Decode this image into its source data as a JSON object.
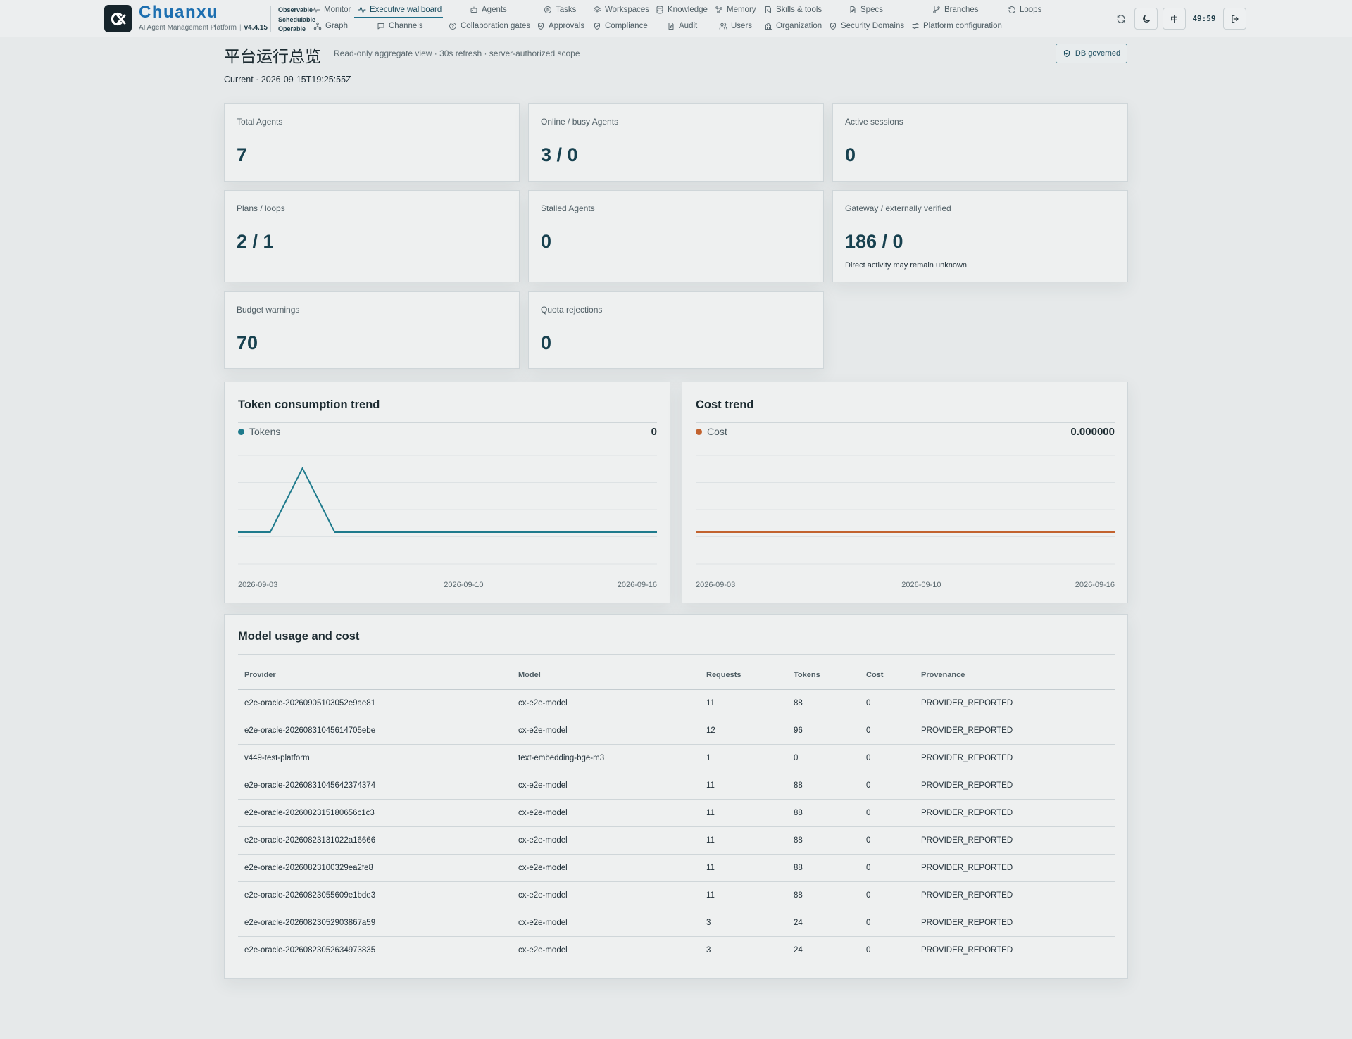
{
  "brand": {
    "name": "Chuanxu",
    "subtitle": "AI Agent Management Platform",
    "version": "v4.4.15",
    "badges": [
      "Observable",
      "Schedulable",
      "Operable"
    ]
  },
  "nav": {
    "row1": [
      {
        "label": "Monitor",
        "icon": "pulse-icon"
      },
      {
        "label": "Executive wallboard",
        "icon": "activity-icon",
        "active": true
      },
      {
        "label": "Agents",
        "icon": "robot-icon"
      },
      {
        "label": "Tasks",
        "icon": "play-circle-icon"
      },
      {
        "label": "Workspaces",
        "icon": "layers-icon"
      },
      {
        "label": "Knowledge",
        "icon": "database-icon"
      },
      {
        "label": "Memory",
        "icon": "nodes-icon"
      },
      {
        "label": "Skills & tools",
        "icon": "tool-icon"
      },
      {
        "label": "Specs",
        "icon": "doc-edit-icon"
      },
      {
        "label": "Branches",
        "icon": "branch-icon"
      },
      {
        "label": "Loops",
        "icon": "refresh-icon"
      }
    ],
    "row2": [
      {
        "label": "Graph",
        "icon": "graph-icon"
      },
      {
        "label": "Channels",
        "icon": "chat-icon"
      },
      {
        "label": "Collaboration gates",
        "icon": "help-circle-icon"
      },
      {
        "label": "Approvals",
        "icon": "shield-check-icon"
      },
      {
        "label": "Compliance",
        "icon": "shield-check-icon"
      },
      {
        "label": "Audit",
        "icon": "doc-edit-icon"
      },
      {
        "label": "Users",
        "icon": "users-icon"
      },
      {
        "label": "Organization",
        "icon": "building-icon"
      },
      {
        "label": "Security Domains",
        "icon": "shield-check-icon"
      },
      {
        "label": "Platform configuration",
        "icon": "sliders-icon"
      }
    ]
  },
  "toolbar": {
    "language_label": "中",
    "session_timer": "49:59"
  },
  "header": {
    "title": "平台运行总览",
    "subtitle": "Read-only aggregate view · 30s refresh · server-authorized scope",
    "db_badge": "DB governed",
    "current": "Current · 2026-09-15T19:25:55Z"
  },
  "stats": [
    {
      "label": "Total Agents",
      "value": "7"
    },
    {
      "label": "Online / busy Agents",
      "value": "3 / 0"
    },
    {
      "label": "Active sessions",
      "value": "0"
    },
    {
      "label": "Plans / loops",
      "value": "2 / 1"
    },
    {
      "label": "Stalled Agents",
      "value": "0"
    },
    {
      "label": "Gateway / externally verified",
      "value": "186 / 0",
      "note": "Direct activity may remain unknown"
    },
    {
      "label": "Budget warnings",
      "value": "70"
    },
    {
      "label": "Quota rejections",
      "value": "0"
    }
  ],
  "charts": {
    "tokens": {
      "title": "Token consumption trend",
      "series_label": "Tokens",
      "latest": "0",
      "color": "#1e7a8c"
    },
    "cost": {
      "title": "Cost trend",
      "series_label": "Cost",
      "latest": "0.000000",
      "color": "#c2622e"
    }
  },
  "chart_data": [
    {
      "type": "line",
      "title": "Token consumption trend",
      "x": [
        "2026-09-03",
        "2026-09-04",
        "2026-09-05",
        "2026-09-06",
        "2026-09-07",
        "2026-09-08",
        "2026-09-09",
        "2026-09-10",
        "2026-09-11",
        "2026-09-12",
        "2026-09-13",
        "2026-09-14",
        "2026-09-15",
        "2026-09-16"
      ],
      "series": [
        {
          "name": "Tokens",
          "values": [
            0,
            0,
            100,
            0,
            0,
            0,
            0,
            0,
            0,
            0,
            0,
            0,
            0,
            0
          ]
        }
      ],
      "x_tick_labels": [
        "2026-09-03",
        "2026-09-10",
        "2026-09-16"
      ],
      "grid": true,
      "legend": "top-left"
    },
    {
      "type": "line",
      "title": "Cost trend",
      "x": [
        "2026-09-03",
        "2026-09-04",
        "2026-09-05",
        "2026-09-06",
        "2026-09-07",
        "2026-09-08",
        "2026-09-09",
        "2026-09-10",
        "2026-09-11",
        "2026-09-12",
        "2026-09-13",
        "2026-09-14",
        "2026-09-15",
        "2026-09-16"
      ],
      "series": [
        {
          "name": "Cost",
          "values": [
            0,
            0,
            0,
            0,
            0,
            0,
            0,
            0,
            0,
            0,
            0,
            0,
            0,
            0
          ]
        }
      ],
      "x_tick_labels": [
        "2026-09-03",
        "2026-09-10",
        "2026-09-16"
      ],
      "grid": true,
      "legend": "top-left"
    }
  ],
  "model_table": {
    "title": "Model usage and cost",
    "columns": [
      "Provider",
      "Model",
      "Requests",
      "Tokens",
      "Cost",
      "Provenance"
    ],
    "rows": [
      [
        "e2e-oracle-20260905103052e9ae81",
        "cx-e2e-model",
        "11",
        "88",
        "0",
        "PROVIDER_REPORTED"
      ],
      [
        "e2e-oracle-20260831045614705ebe",
        "cx-e2e-model",
        "12",
        "96",
        "0",
        "PROVIDER_REPORTED"
      ],
      [
        "v449-test-platform",
        "text-embedding-bge-m3",
        "1",
        "0",
        "0",
        "PROVIDER_REPORTED"
      ],
      [
        "e2e-oracle-20260831045642374374",
        "cx-e2e-model",
        "11",
        "88",
        "0",
        "PROVIDER_REPORTED"
      ],
      [
        "e2e-oracle-202608231518065 6c1c3",
        "cx-e2e-model",
        "11",
        "88",
        "0",
        "PROVIDER_REPORTED"
      ],
      [
        "e2e-oracle-20260823131022a16666",
        "cx-e2e-model",
        "11",
        "88",
        "0",
        "PROVIDER_REPORTED"
      ],
      [
        "e2e-oracle-20260823100329ea2fe8",
        "cx-e2e-model",
        "11",
        "88",
        "0",
        "PROVIDER_REPORTED"
      ],
      [
        "e2e-oracle-20260823055609e1bde3",
        "cx-e2e-model",
        "11",
        "88",
        "0",
        "PROVIDER_REPORTED"
      ],
      [
        "e2e-oracle-20260823052903867a59",
        "cx-e2e-model",
        "3",
        "24",
        "0",
        "PROVIDER_REPORTED"
      ],
      [
        "e2e-oracle-20260823052634973835",
        "cx-e2e-model",
        "3",
        "24",
        "0",
        "PROVIDER_REPORTED"
      ]
    ]
  }
}
